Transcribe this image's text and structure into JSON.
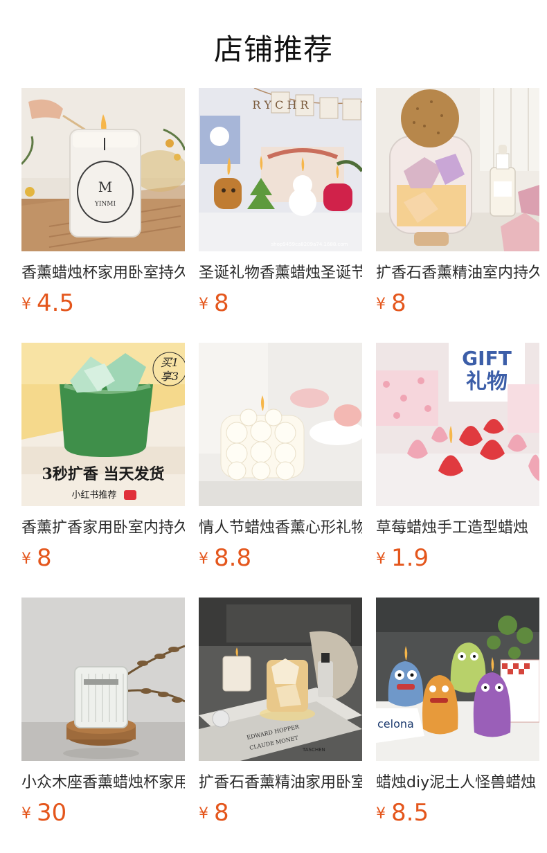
{
  "section": {
    "title": "店铺推荐"
  },
  "currency_symbol": "¥",
  "colors": {
    "price": "#e4561c",
    "title": "#111111",
    "product_name": "#2b2b2b"
  },
  "products": [
    {
      "name": "香薰蜡烛杯家用卧室持久",
      "price": "4.5",
      "image": "glass-jar-candle-with-match",
      "image_text": {
        "label_brand": "YINMI",
        "label_logo": "M"
      }
    },
    {
      "name": "圣诞礼物香薰蜡烛圣诞节",
      "price": "8",
      "image": "christmas-shaped-candles",
      "image_text": {
        "banner": "R Y C H R",
        "watermark": "shop9459ca8209a74.1688.com"
      }
    },
    {
      "name": "扩香石香薰精油室内持久",
      "price": "8",
      "image": "cork-ball-crystal-jar-with-oil"
    },
    {
      "name": "香薰扩香家用卧室内持久",
      "price": "8",
      "image": "green-glass-aroma-stones",
      "image_text": {
        "badge": "买1\n享3",
        "headline": "3秒扩香 当天发货",
        "footer": "小红书推荐",
        "footer_tag": "小红书"
      }
    },
    {
      "name": "情人节蜡烛香薰心形礼物",
      "price": "8.8",
      "image": "white-heart-bubble-candle"
    },
    {
      "name": "草莓蜡烛手工造型蜡烛",
      "price": "1.9",
      "image": "strawberry-candles",
      "image_text": {
        "gift": "GIFT",
        "gift_cn": "礼物"
      }
    },
    {
      "name": "小众木座香薰蜡烛杯家用",
      "price": "30",
      "image": "ribbed-glass-candle-wood-base"
    },
    {
      "name": "扩香石香薰精油家用卧室",
      "price": "8",
      "image": "aroma-stone-lamp-on-books",
      "image_text": {
        "book1": "EDWARD HOPPER",
        "book2": "CLAUDE MONET",
        "book3": "TASCHEN"
      }
    },
    {
      "name": "蜡烛diy泥土人怪兽蜡烛",
      "price": "8.5",
      "image": "monster-figure-candles",
      "image_text": {
        "book": "celona"
      }
    }
  ]
}
